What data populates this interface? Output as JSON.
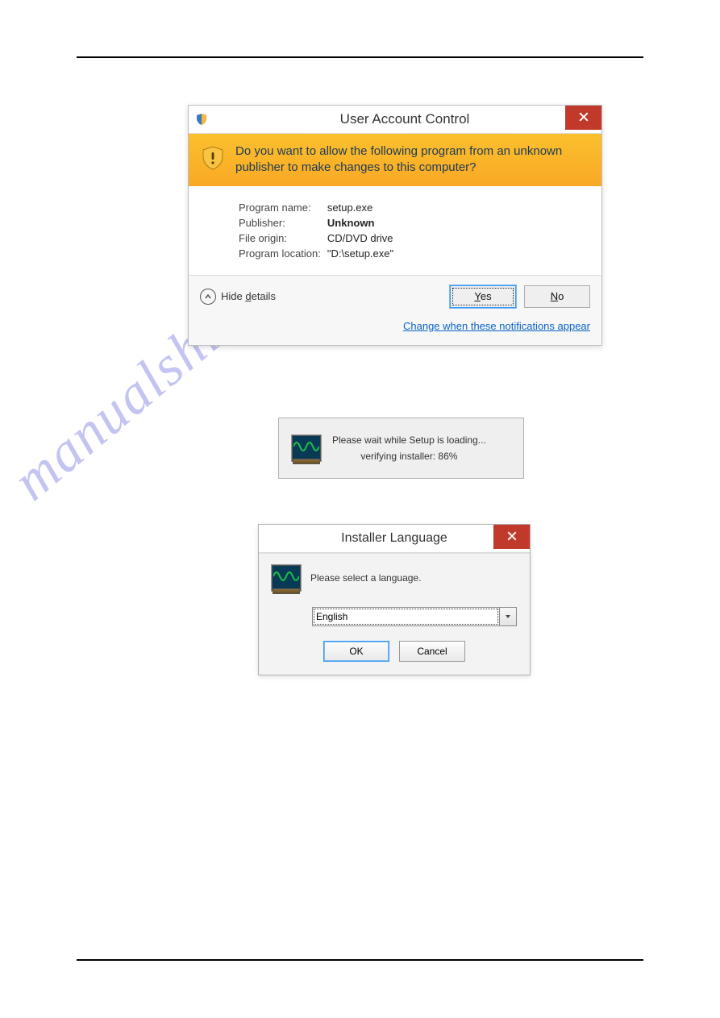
{
  "watermark": "manualshive.com",
  "uac": {
    "title": "User Account Control",
    "question": "Do you want to allow the following program from an unknown publisher to make changes to this computer?",
    "labels": {
      "program_name": "Program name:",
      "publisher": "Publisher:",
      "file_origin": "File origin:",
      "program_location": "Program location:"
    },
    "values": {
      "program_name": "setup.exe",
      "publisher": "Unknown",
      "file_origin": "CD/DVD drive",
      "program_location": "\"D:\\setup.exe\""
    },
    "hide_details": "Hide details",
    "hide_details_key": "d",
    "yes": "Yes",
    "no": "No",
    "link": "Change when these notifications appear"
  },
  "loading": {
    "line1": "Please wait while Setup is loading...",
    "line2": "verifying installer: 86%"
  },
  "lang": {
    "title": "Installer Language",
    "prompt": "Please select a language.",
    "selected": "English",
    "ok": "OK",
    "cancel": "Cancel"
  }
}
